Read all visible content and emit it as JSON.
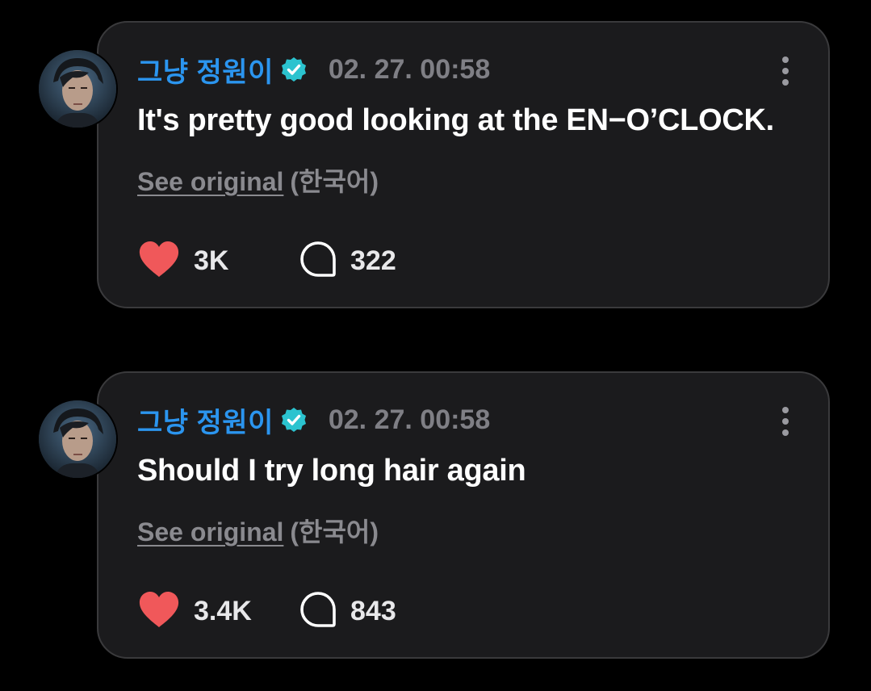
{
  "posts": [
    {
      "author": "그냥 정원이",
      "timestamp": "02. 27. 00:58",
      "message": "It's pretty good looking at the EN−O’CLOCK.",
      "see_original": "See original",
      "language": "(한국어)",
      "likes": "3K",
      "comments": "322"
    },
    {
      "author": "그냥 정원이",
      "timestamp": "02. 27. 00:58",
      "message": "Should I try long hair again",
      "see_original": "See original",
      "language": "(한국어)",
      "likes": "3.4K",
      "comments": "843"
    }
  ],
  "icons": {
    "verified": "verified-badge-icon",
    "more": "more-vertical-icon",
    "like": "heart-icon",
    "comment": "comment-bubble-icon"
  },
  "colors": {
    "background": "#000000",
    "card": "#1b1b1d",
    "card_border": "#3a3a3c",
    "author": "#2b95ef",
    "verified": "#2bc3cf",
    "timestamp": "#7f7f85",
    "heart": "#f0585a"
  }
}
